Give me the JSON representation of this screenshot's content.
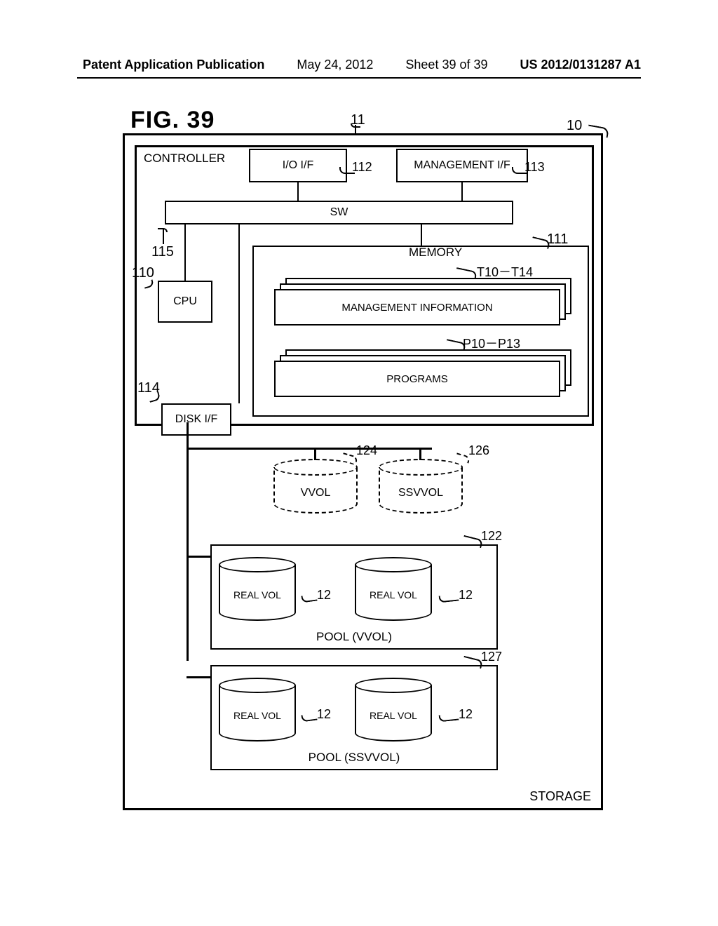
{
  "header": {
    "publication": "Patent Application Publication",
    "date": "May 24, 2012",
    "sheet": "Sheet 39 of 39",
    "pubno": "US 2012/0131287 A1"
  },
  "fig": {
    "title": "FIG. 39"
  },
  "labels": {
    "storage": "STORAGE",
    "controller": "CONTROLLER",
    "io_if": "I/O  I/F",
    "mgmt_if": "MANAGEMENT I/F",
    "sw": "SW",
    "cpu": "CPU",
    "memory": "MEMORY",
    "disk_if": "DISK I/F",
    "mgmt_info": "MANAGEMENT INFORMATION",
    "programs": "PROGRAMS",
    "vvol": "VVOL",
    "ssvvol": "SSVVOL",
    "real_vol": "REAL VOL",
    "pool_vvol": "POOL (VVOL)",
    "pool_ssvvol": "POOL (SSVVOL)"
  },
  "refs": {
    "r10": "10",
    "r11": "11",
    "r110": "110",
    "r111": "111",
    "r112": "112",
    "r113": "113",
    "r114": "114",
    "r115": "115",
    "t10": "T10－T14",
    "p10": "P10－P13",
    "r122": "122",
    "r124": "124",
    "r126": "126",
    "r127": "127",
    "r12": "12"
  }
}
